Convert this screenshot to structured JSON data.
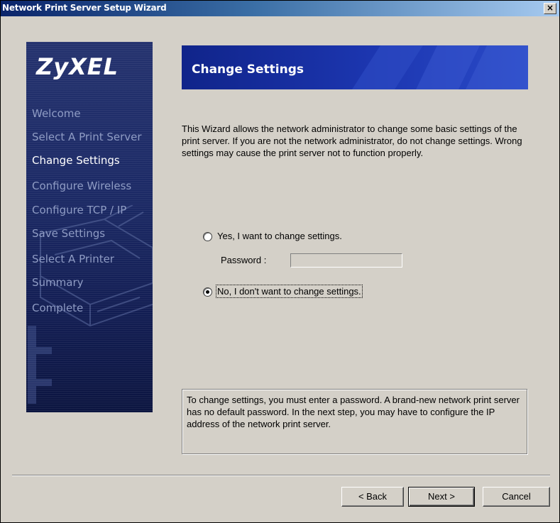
{
  "window": {
    "title": "Network Print Server Setup Wizard",
    "close_label": "×"
  },
  "sidebar": {
    "logo": "ZyXEL",
    "steps": [
      {
        "label": "Welcome",
        "active": false
      },
      {
        "label": "Select A Print Server",
        "active": false
      },
      {
        "label": "Change Settings",
        "active": true
      },
      {
        "label": "Configure Wireless",
        "active": false
      },
      {
        "label": "Configure  TCP / IP",
        "active": false
      },
      {
        "label": "Save Settings",
        "active": false
      },
      {
        "label": "Select A Printer",
        "active": false
      },
      {
        "label": "Summary",
        "active": false
      },
      {
        "label": "Complete",
        "active": false
      }
    ]
  },
  "header": {
    "title": "Change Settings"
  },
  "intro": "This Wizard allows the network administrator to change some basic settings of the print server. If you are not the network administrator, do not change settings. Wrong settings may cause the print server not to function properly.",
  "options": {
    "yes_label": "Yes, I want to change settings.",
    "no_label": "No, I don't want to change settings.",
    "selected": "no",
    "password_label": "Password :",
    "password_value": ""
  },
  "info": "To change settings, you must enter a password. A brand-new network print server has no default password. In the next step, you may have to configure the IP address of the network print server.",
  "buttons": {
    "back": "< Back",
    "next": "Next >",
    "cancel": "Cancel"
  },
  "colors": {
    "dialog_bg": "#d4d0c8",
    "banner": "#1c36b0",
    "sidebar": "#1c2a66",
    "title_bar": "#0a246a"
  }
}
